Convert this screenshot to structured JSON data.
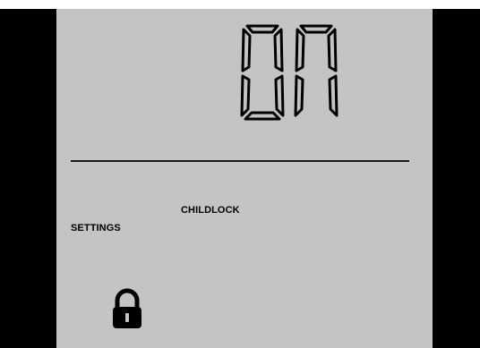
{
  "display": {
    "value_text": "ON",
    "digits": [
      {
        "char": "O",
        "segments": [
          "a",
          "b",
          "c",
          "d",
          "e",
          "f"
        ]
      },
      {
        "char": "N",
        "segments": [
          "a",
          "b",
          "c",
          "e",
          "f"
        ]
      }
    ]
  },
  "labels": {
    "mode": "CHILDLOCK",
    "menu": "SETTINGS"
  },
  "icons": {
    "lock": "padlock-open-icon"
  },
  "colors": {
    "lcd_background": "#c4c4c4",
    "bezel": "#000000",
    "segment": "#000000"
  }
}
